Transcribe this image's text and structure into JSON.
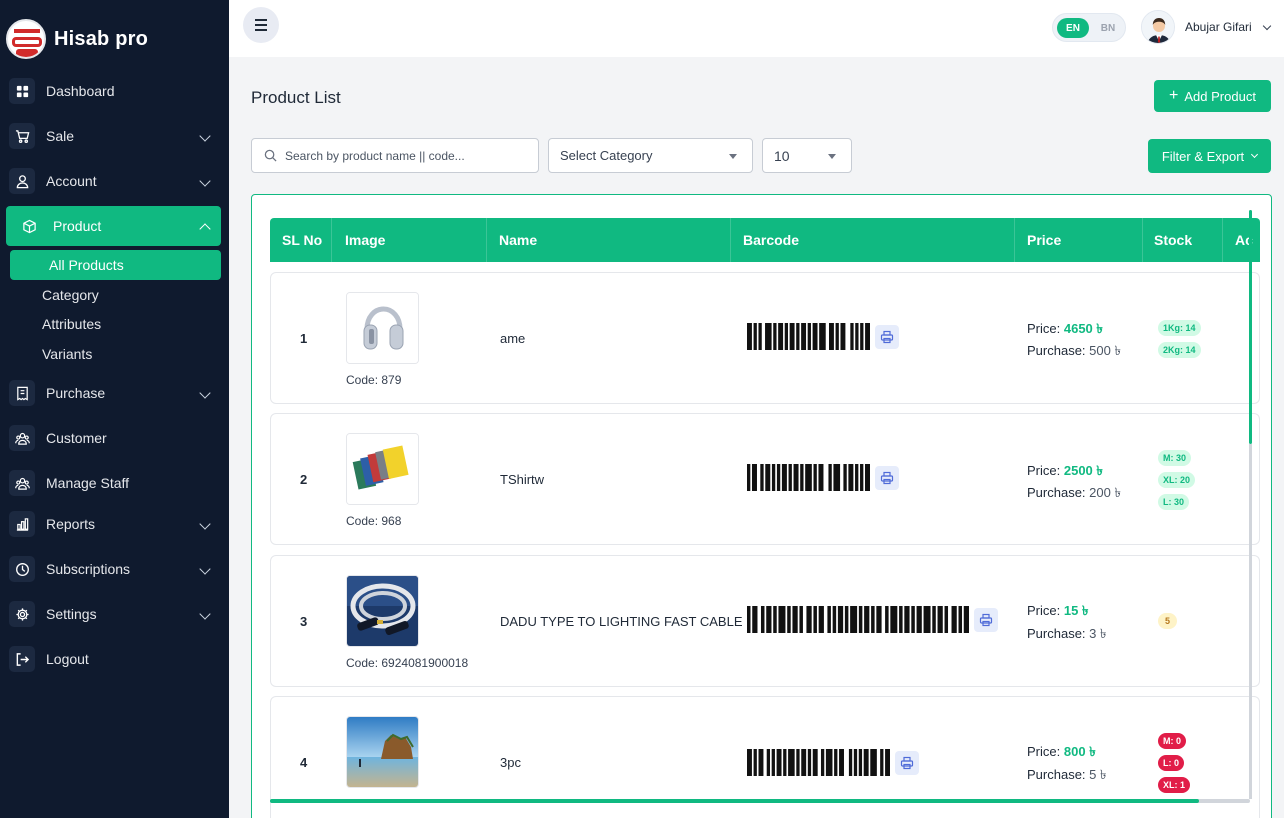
{
  "brand": {
    "name": "Hisab pro"
  },
  "sidebar": {
    "items": [
      {
        "label": "Dashboard",
        "icon": "dashboard-icon"
      },
      {
        "label": "Sale",
        "icon": "cart-icon",
        "has_chevron": true
      },
      {
        "label": "Account",
        "icon": "user-icon",
        "has_chevron": true
      },
      {
        "label": "Product",
        "icon": "box-icon",
        "has_chevron": true,
        "active": true
      },
      {
        "label": "Purchase",
        "icon": "receipt-icon",
        "has_chevron": true
      },
      {
        "label": "Customer",
        "icon": "users-icon"
      },
      {
        "label": "Manage Staff",
        "icon": "staff-icon"
      },
      {
        "label": "Reports",
        "icon": "chart-icon",
        "has_chevron": true
      },
      {
        "label": "Subscriptions",
        "icon": "clock-icon",
        "has_chevron": true
      },
      {
        "label": "Settings",
        "icon": "gear-icon",
        "has_chevron": true
      },
      {
        "label": "Logout",
        "icon": "logout-icon"
      }
    ],
    "product_sub": [
      {
        "label": "All Products",
        "active": true
      },
      {
        "label": "Category"
      },
      {
        "label": "Attributes"
      },
      {
        "label": "Variants"
      }
    ]
  },
  "topbar": {
    "lang_en": "EN",
    "lang_bn": "BN",
    "user_name": "Abujar Gifari"
  },
  "main": {
    "title": "Product List",
    "add_button": "Add Product",
    "search_placeholder": "Search by product name || code...",
    "category_select": "Select Category",
    "per_page": "10",
    "filter_button": "Filter & Export"
  },
  "table": {
    "headers": [
      "SL No",
      "Image",
      "Name",
      "Barcode",
      "Price",
      "Stock",
      "Ac"
    ],
    "code_label": "Code:",
    "price_label": "Price:",
    "purchase_label": "Purchase:",
    "currency": "৳",
    "rows": [
      {
        "sl": "1",
        "code": "879",
        "name": "ame",
        "price": "4650",
        "purchase": "500",
        "stock": [
          {
            "text": "1Kg: 14",
            "level": "green"
          },
          {
            "text": "2Kg: 14",
            "level": "green"
          }
        ]
      },
      {
        "sl": "2",
        "code": "968",
        "name": "TShirtw",
        "price": "2500",
        "purchase": "200",
        "stock": [
          {
            "text": "M: 30",
            "level": "green"
          },
          {
            "text": "XL: 20",
            "level": "green"
          },
          {
            "text": "L: 30",
            "level": "green"
          }
        ]
      },
      {
        "sl": "3",
        "code": "6924081900018",
        "name": "DADU TYPE TO LIGHTING FAST CABLE",
        "price": "15",
        "purchase": "3",
        "stock": [
          {
            "text": "5",
            "level": "yellow"
          }
        ]
      },
      {
        "sl": "4",
        "code": "",
        "name": "3pc",
        "price": "800",
        "purchase": "5",
        "stock": [
          {
            "text": "M: 0",
            "level": "red"
          },
          {
            "text": "L: 0",
            "level": "red"
          },
          {
            "text": "XL: 1",
            "level": "red"
          }
        ]
      }
    ]
  },
  "colors": {
    "accent": "#10b981",
    "sidebar_bg": "#0f1a2e",
    "danger": "#e11d48"
  }
}
